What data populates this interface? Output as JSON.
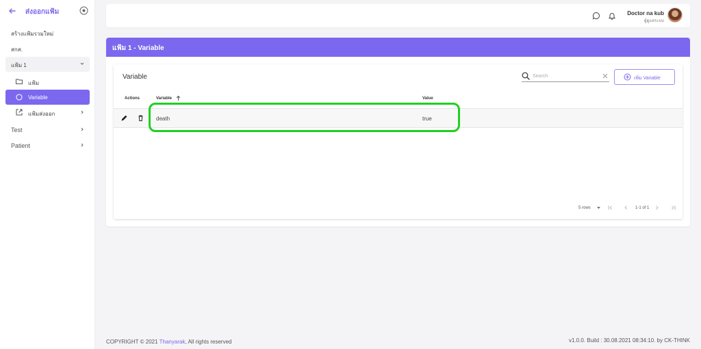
{
  "sidebar": {
    "title": "ส่งออกแฟ้ม",
    "items": [
      {
        "label": "สร้างแฟ้มรวมใหม่"
      },
      {
        "label": "สกส."
      },
      {
        "label": "แฟ้ม 1"
      },
      {
        "label": "แฟ้ม"
      },
      {
        "label": "Variable"
      },
      {
        "label": "แฟ้มส่งออก"
      },
      {
        "label": "Test"
      },
      {
        "label": "Patient"
      }
    ]
  },
  "topbar": {
    "user_name": "Doctor na kub",
    "user_role": "ผู้ดูแลระบบ"
  },
  "card": {
    "title": "แฟ้ม 1 - Variable",
    "inner_title": "Variable",
    "search_placeholder": "Search",
    "add_button": "เพิ่ม Variable"
  },
  "table": {
    "columns": [
      "Actions",
      "Variable",
      "Value"
    ],
    "rows": [
      {
        "variable": "death",
        "value": "true"
      }
    ]
  },
  "pagination": {
    "rows_per_page": "5 rows",
    "range": "1-1 of 1"
  },
  "footer": {
    "copyright_prefix": "COPYRIGHT © 2021 ",
    "company": "Thanyarak",
    "copyright_suffix": ", All rights reserved",
    "version": "v1.0.0. Build : 30.08.2021 08:34:10. by CK-THINK"
  },
  "colors": {
    "accent": "#7b68ee",
    "highlight": "#1ed020"
  }
}
